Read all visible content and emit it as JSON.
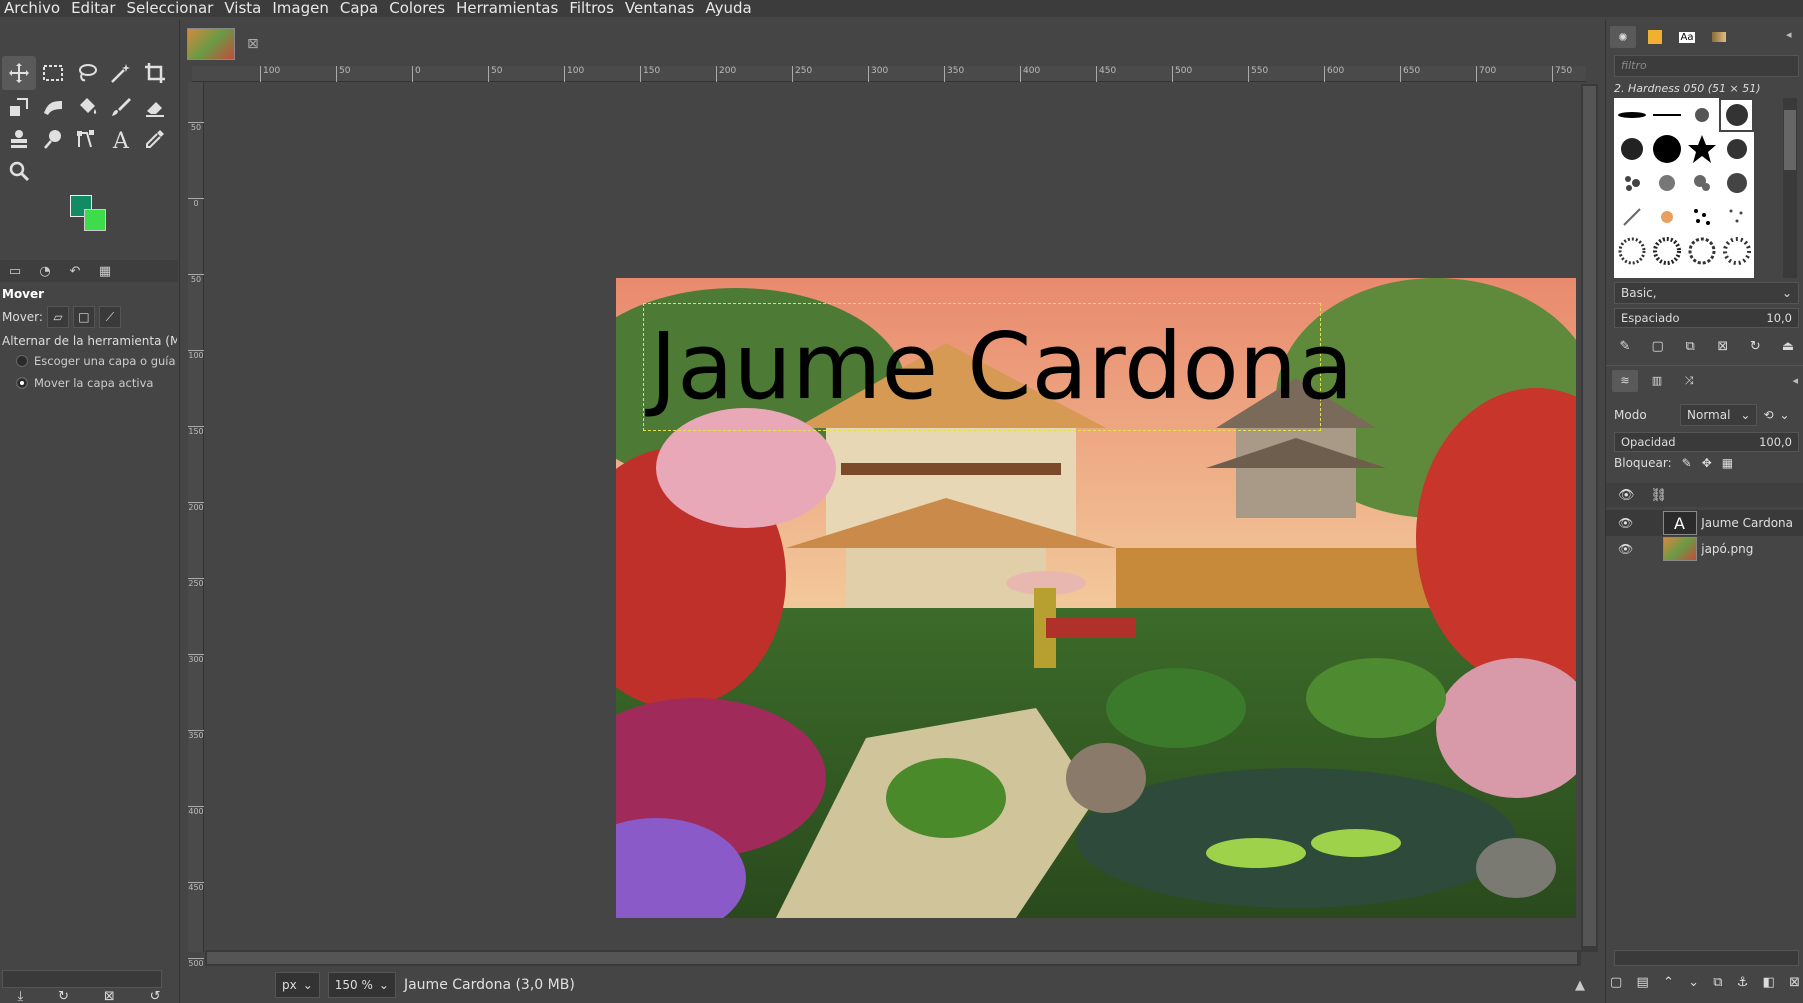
{
  "menu": [
    "Archivo",
    "Editar",
    "Seleccionar",
    "Vista",
    "Imagen",
    "Capa",
    "Colores",
    "Herramientas",
    "Filtros",
    "Ventanas",
    "Ayuda"
  ],
  "tool_options": {
    "title": "Mover",
    "move_label": "Mover:",
    "toggle_label": "Alternar de la herramienta  (Mayús)",
    "option_pick": "Escoger una capa o guía",
    "option_active": "Mover la capa activa"
  },
  "ruler": {
    "h_ticks": [
      "100",
      "50",
      "0",
      "50",
      "100",
      "150",
      "200",
      "250",
      "300",
      "350",
      "400",
      "450",
      "500",
      "550",
      "600",
      "650",
      "700",
      "750"
    ],
    "v_ticks": [
      "50",
      "0",
      "50",
      "100",
      "150",
      "200",
      "250",
      "300",
      "350",
      "400",
      "450",
      "500"
    ]
  },
  "canvas": {
    "text_layer": "Jaume Cardona"
  },
  "status": {
    "unit": "px",
    "zoom": "150 %",
    "text": "Jaume Cardona (3,0 MB)"
  },
  "brushes": {
    "filter_placeholder": "filtro",
    "selected_name": "2. Hardness 050 (51 × 51)",
    "preset": "Basic,",
    "spacing_label": "Espaciado",
    "spacing_value": "10,0"
  },
  "layers": {
    "mode_label": "Modo",
    "mode_value": "Normal",
    "opacity_label": "Opacidad",
    "opacity_value": "100,0",
    "lock_label": "Bloquear:",
    "items": [
      {
        "name": "Jaume Cardona"
      },
      {
        "name": "japó.png"
      }
    ]
  },
  "colors": {
    "foreground": "#128a63",
    "background": "#3ddc4a",
    "selection_border": "#e4e14a"
  }
}
